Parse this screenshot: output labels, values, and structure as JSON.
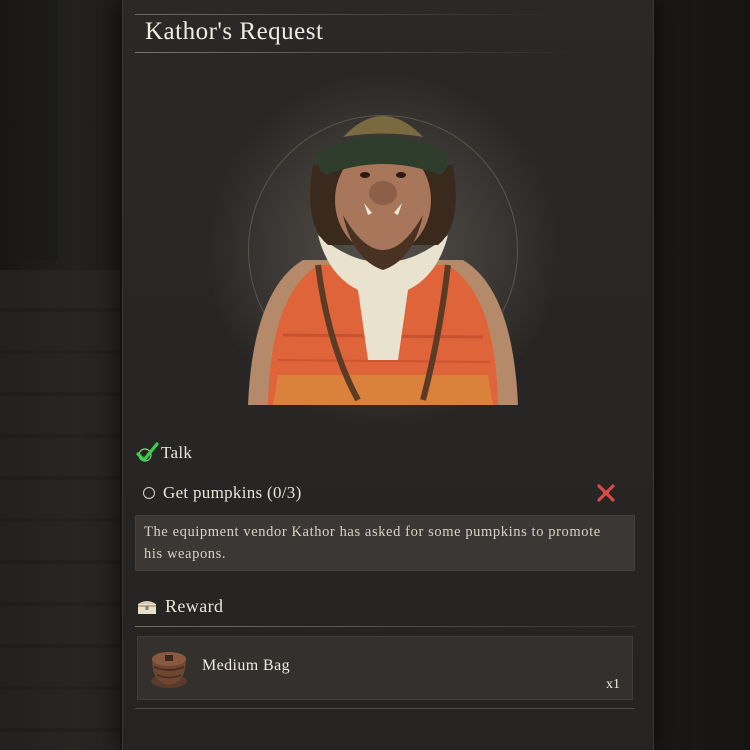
{
  "quest": {
    "title": "Kathor's Request",
    "portrait_icon": "orc-vendor-portrait"
  },
  "objectives": [
    {
      "label": "Talk",
      "status": "complete",
      "icon": "check-icon"
    },
    {
      "label": "Get pumpkins (0/3)",
      "status": "incomplete",
      "icon": "circle-icon",
      "action_icon": "cross-icon"
    }
  ],
  "description": "The equipment vendor Kathor has asked for some pumpkins to promote his weapons.",
  "reward": {
    "title": "Reward",
    "icon": "chest-icon",
    "items": [
      {
        "name": "Medium Bag",
        "quantity": "x1",
        "icon": "bag-icon"
      }
    ]
  },
  "colors": {
    "check": "#3bd04a",
    "cross": "#d84a44",
    "vest": "#e0643a"
  }
}
